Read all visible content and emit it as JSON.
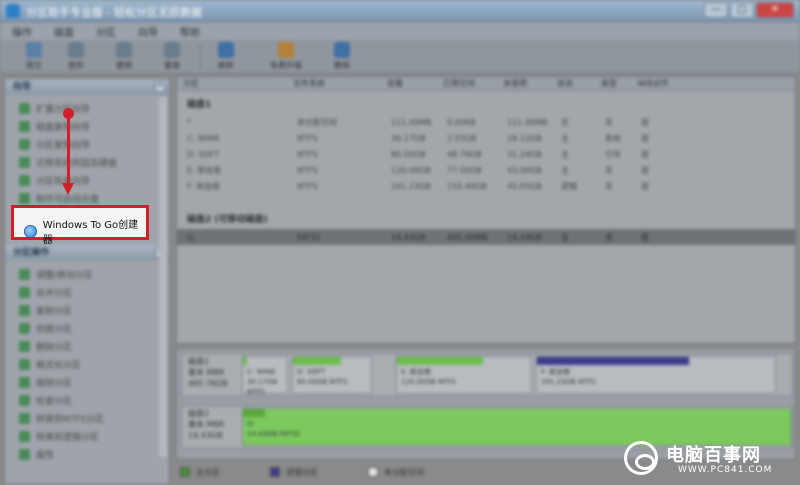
{
  "window": {
    "title": "分区助手专业版 - 轻松分区无损数据",
    "min": "—",
    "max": "□",
    "close": "✕"
  },
  "menu": [
    "操作",
    "磁盘",
    "分区",
    "向导",
    "帮助"
  ],
  "toolbar": [
    {
      "label": "提交",
      "icon": "commit-icon",
      "color": "#5c7fa6"
    },
    {
      "label": "放弃",
      "icon": "discard-icon",
      "color": "#6a7c8e"
    },
    {
      "label": "撤销",
      "icon": "undo-icon",
      "color": "#6a7c8e"
    },
    {
      "label": "重做",
      "icon": "redo-icon",
      "color": "#6a7c8e"
    },
    {
      "label": "刷新",
      "icon": "refresh-icon",
      "color": "#3f6fa3"
    },
    {
      "label": "免费升级",
      "icon": "upgrade-icon",
      "color": "#b5803a"
    },
    {
      "label": "教程",
      "icon": "tutorial-icon",
      "color": "#3f6fa3"
    }
  ],
  "sidebar": {
    "wizard_title": "向导",
    "wizard_items": [
      "扩展分区向导",
      "磁盘复制向导",
      "分区复制向导",
      "迁移系统到固态硬盘",
      "分区恢复向导",
      "制作可启动光盘"
    ],
    "ops_title": "分区操作",
    "ops_items": [
      "调整/移动分区",
      "合并分区",
      "复制分区",
      "创建分区",
      "删除分区",
      "格式化分区",
      "擦除分区",
      "检查分区",
      "转换到NTFS分区",
      "转换到逻辑分区",
      "属性"
    ],
    "highlight_label": "Windows To Go创建器"
  },
  "table": {
    "headers": [
      "分区",
      "文件系统",
      "容量",
      "已用空间",
      "未使用",
      "状态",
      "类型",
      "4KB对齐"
    ],
    "group1": "磁盘1",
    "rows1": [
      [
        "*",
        "未分配空间",
        "111.00MB",
        "0.00KB",
        "111.00MB",
        "无",
        "无",
        "是"
      ],
      [
        "C: WIN8",
        "NTFS",
        "30.17GB",
        "2.55GB",
        "28.12GB",
        "主",
        "系统",
        "是"
      ],
      [
        "D: SOFT",
        "NTFS",
        "80.00GB",
        "48.76GB",
        "31.24GB",
        "主",
        "引导",
        "是"
      ],
      [
        "E: 新加卷",
        "NTFS",
        "120.00GB",
        "77.00GB",
        "43.00GB",
        "主",
        "无",
        "是"
      ],
      [
        "F: 新加卷",
        "NTFS",
        "241.23GB",
        "155.49GB",
        "45.05GB",
        "逻辑",
        "无",
        "是"
      ]
    ],
    "group2": "磁盘2 (可移动磁盘)",
    "rows2": [
      [
        "G:",
        "FAT32",
        "14.43GB",
        "491.00MB",
        "14.44GB",
        "主",
        "无",
        "是"
      ]
    ]
  },
  "disks": [
    {
      "name": "磁盘1",
      "type": "基本 MBR",
      "size": "465.76GB",
      "partitions": [
        {
          "label": "C: WIN8",
          "detail": "30.17GB NTFS",
          "fill": 0.08
        },
        {
          "label": "D: SOFT",
          "detail": "80.00GB NTFS",
          "fill": 0.61
        },
        {
          "label": "E: 新加卷",
          "detail": "120.00GB NTFS",
          "fill": 0.64
        },
        {
          "label": "F: 新加卷",
          "detail": "241.23GB NTFS",
          "fill": 0.64
        }
      ]
    },
    {
      "name": "磁盘2",
      "type": "基本 MBR",
      "size": "14.43GB",
      "partitions": [
        {
          "label": "G:",
          "detail": "14.43GB FAT32",
          "fill": 0.03
        }
      ]
    }
  ],
  "legend": [
    {
      "label": "主分区",
      "color": "#4a8a3a"
    },
    {
      "label": "逻辑分区",
      "color": "#3c3c8c"
    },
    {
      "label": "未分配空间",
      "color": "#e8e8e8"
    }
  ],
  "colors": {
    "highlight_border": "#d0202a",
    "partition_green": "#6bbf4e",
    "partition_blue": "#3c3c8c"
  },
  "watermark": {
    "text": "电脑百事网",
    "url": "WWW.PC841.COM"
  }
}
